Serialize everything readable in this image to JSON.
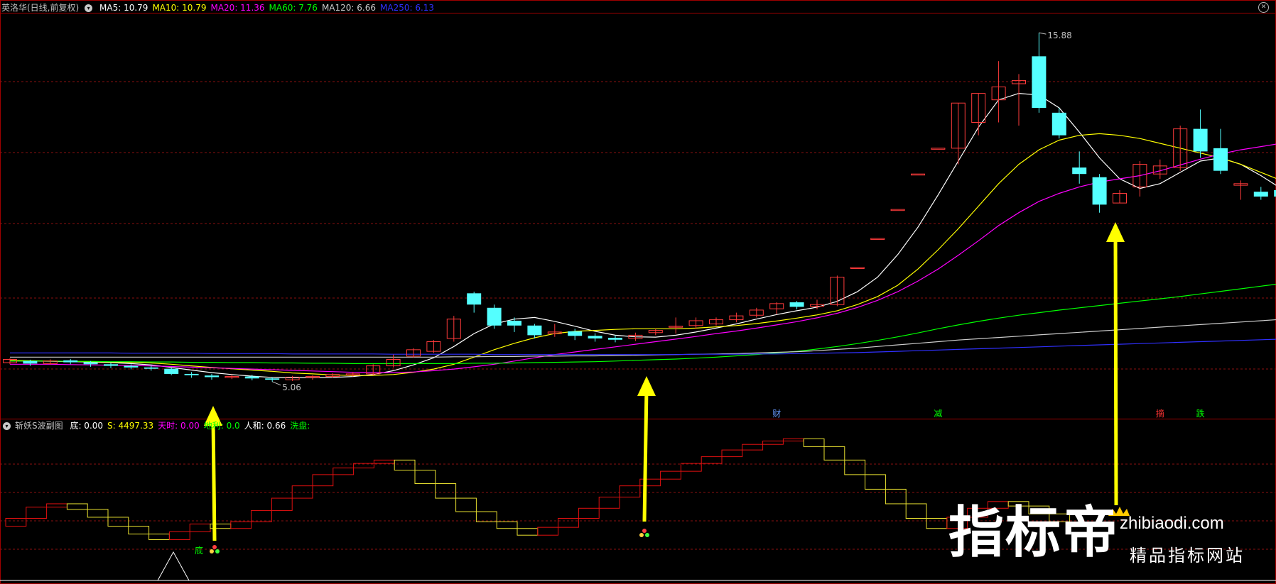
{
  "main_legend": {
    "title": "英洛华(日线,前复权)",
    "items": [
      {
        "label": "MA5: 10.79",
        "color": "#ffffff"
      },
      {
        "label": "MA10: 10.79",
        "color": "#ffff00"
      },
      {
        "label": "MA20: 11.36",
        "color": "#ff00ff"
      },
      {
        "label": "MA60: 7.76",
        "color": "#00ff00"
      },
      {
        "label": "MA120: 6.66",
        "color": "#cccccc"
      },
      {
        "label": "MA250: 6.13",
        "color": "#3030ff"
      }
    ]
  },
  "sub_legend": {
    "title": "斩妖S波副图",
    "items": [
      {
        "label": "底: 0.00",
        "color": "#ffffff"
      },
      {
        "label": "S: 4497.33",
        "color": "#ffff00"
      },
      {
        "label": "天时: 0.00",
        "color": "#ff00ff"
      },
      {
        "label": "地利: 0.0",
        "color": "#00ff00"
      },
      {
        "label": "人和: 0.66",
        "color": "#ffffff"
      },
      {
        "label": "洗盘:",
        "color": "#00ff00"
      }
    ]
  },
  "chart_data": {
    "type": "candlestick",
    "price_range": [
      4.0,
      16.5
    ],
    "annotations": {
      "high_label": "15.88",
      "low_label": "5.06",
      "bottom_label": "底"
    },
    "event_labels": [
      {
        "text": "财",
        "candle": 38,
        "color": "#6699ff"
      },
      {
        "text": "减",
        "candle": 46,
        "color": "#00ff00"
      },
      {
        "text": "摘",
        "candle": 57,
        "color": "#ff3333"
      },
      {
        "text": "跌",
        "candle": 59,
        "color": "#00ff00"
      }
    ],
    "candles": [
      [
        5.65,
        5.75,
        5.6,
        5.78
      ],
      [
        5.7,
        5.62,
        5.55,
        5.74
      ],
      [
        5.62,
        5.7,
        5.58,
        5.75
      ],
      [
        5.72,
        5.66,
        5.6,
        5.76
      ],
      [
        5.66,
        5.6,
        5.52,
        5.7
      ],
      [
        5.6,
        5.55,
        5.48,
        5.64
      ],
      [
        5.55,
        5.5,
        5.44,
        5.6
      ],
      [
        5.5,
        5.46,
        5.4,
        5.56
      ],
      [
        5.46,
        5.3,
        5.26,
        5.5
      ],
      [
        5.3,
        5.26,
        5.18,
        5.36
      ],
      [
        5.25,
        5.2,
        5.12,
        5.3
      ],
      [
        5.2,
        5.22,
        5.14,
        5.28
      ],
      [
        5.22,
        5.16,
        5.1,
        5.27
      ],
      [
        5.16,
        5.12,
        5.06,
        5.2
      ],
      [
        5.12,
        5.2,
        5.08,
        5.24
      ],
      [
        5.2,
        5.22,
        5.12,
        5.26
      ],
      [
        5.22,
        5.28,
        5.18,
        5.32
      ],
      [
        5.28,
        5.3,
        5.22,
        5.36
      ],
      [
        5.3,
        5.55,
        5.26,
        5.6
      ],
      [
        5.55,
        5.75,
        5.5,
        5.9
      ],
      [
        5.85,
        6.05,
        5.8,
        6.1
      ],
      [
        6.0,
        6.3,
        5.95,
        6.35
      ],
      [
        6.4,
        7.0,
        6.3,
        7.1
      ],
      [
        7.8,
        7.45,
        7.2,
        7.85
      ],
      [
        7.35,
        6.8,
        6.7,
        7.45
      ],
      [
        6.95,
        6.8,
        6.6,
        7.05
      ],
      [
        6.8,
        6.5,
        6.4,
        6.85
      ],
      [
        6.55,
        6.6,
        6.45,
        6.85
      ],
      [
        6.62,
        6.48,
        6.35,
        6.7
      ],
      [
        6.48,
        6.4,
        6.3,
        6.56
      ],
      [
        6.42,
        6.36,
        6.28,
        6.5
      ],
      [
        6.4,
        6.5,
        6.32,
        6.58
      ],
      [
        6.58,
        6.65,
        6.5,
        6.7
      ],
      [
        6.75,
        6.78,
        6.55,
        7.05
      ],
      [
        6.8,
        6.95,
        6.7,
        7.05
      ],
      [
        6.85,
        6.98,
        6.8,
        7.05
      ],
      [
        6.98,
        7.1,
        6.9,
        7.2
      ],
      [
        7.12,
        7.28,
        7.05,
        7.35
      ],
      [
        7.32,
        7.48,
        7.15,
        7.52
      ],
      [
        7.52,
        7.38,
        7.3,
        7.56
      ],
      [
        7.4,
        7.45,
        7.3,
        7.6
      ],
      [
        7.45,
        8.3,
        7.4,
        8.35
      ],
      [
        8.6,
        8.6,
        8.6,
        8.6
      ],
      [
        9.5,
        9.5,
        9.5,
        9.5
      ],
      [
        10.4,
        10.4,
        10.4,
        10.4
      ],
      [
        11.5,
        11.5,
        11.5,
        11.5
      ],
      [
        12.3,
        12.3,
        12.3,
        12.3
      ],
      [
        12.3,
        13.7,
        11.8,
        13.7
      ],
      [
        13.1,
        14.0,
        12.7,
        14.0
      ],
      [
        13.8,
        14.2,
        13.1,
        15.0
      ],
      [
        14.3,
        14.4,
        13.0,
        14.6
      ],
      [
        15.15,
        13.55,
        13.4,
        15.88
      ],
      [
        13.4,
        12.7,
        12.6,
        13.55
      ],
      [
        11.7,
        11.5,
        11.2,
        12.2
      ],
      [
        11.4,
        10.55,
        10.3,
        11.5
      ],
      [
        10.6,
        10.9,
        10.6,
        11.0
      ],
      [
        11.1,
        11.8,
        10.8,
        11.9
      ],
      [
        11.5,
        11.75,
        11.35,
        11.95
      ],
      [
        11.7,
        12.9,
        11.6,
        13.0
      ],
      [
        12.9,
        12.2,
        12.0,
        13.5
      ],
      [
        12.3,
        11.6,
        11.5,
        12.9
      ],
      [
        11.15,
        11.2,
        10.7,
        11.3
      ],
      [
        10.95,
        10.8,
        10.7,
        11.1
      ],
      [
        11.0,
        10.8,
        10.6,
        11.2
      ]
    ],
    "ma_series": [
      {
        "name": "MA5",
        "color": "#ffffff",
        "values": [
          5.7,
          5.7,
          5.69,
          5.68,
          5.67,
          5.65,
          5.62,
          5.58,
          5.5,
          5.42,
          5.34,
          5.28,
          5.23,
          5.19,
          5.18,
          5.18,
          5.19,
          5.22,
          5.28,
          5.4,
          5.58,
          5.8,
          6.15,
          6.55,
          6.85,
          7.0,
          7.05,
          6.93,
          6.78,
          6.62,
          6.5,
          6.45,
          6.44,
          6.5,
          6.6,
          6.72,
          6.85,
          7.0,
          7.14,
          7.26,
          7.37,
          7.55,
          7.85,
          8.3,
          9.0,
          9.85,
          10.85,
          11.9,
          12.95,
          13.8,
          14.0,
          13.95,
          13.55,
          12.8,
          12.0,
          11.35,
          11.05,
          11.2,
          11.55,
          11.9,
          12.0,
          11.8,
          11.45,
          11.05
        ]
      },
      {
        "name": "MA10",
        "color": "#ffff00",
        "values": [
          5.72,
          5.71,
          5.7,
          5.69,
          5.68,
          5.67,
          5.66,
          5.64,
          5.6,
          5.55,
          5.5,
          5.46,
          5.42,
          5.38,
          5.33,
          5.3,
          5.27,
          5.25,
          5.25,
          5.28,
          5.35,
          5.45,
          5.6,
          5.82,
          6.05,
          6.25,
          6.42,
          6.55,
          6.62,
          6.65,
          6.68,
          6.7,
          6.7,
          6.7,
          6.72,
          6.76,
          6.8,
          6.86,
          6.94,
          7.03,
          7.13,
          7.26,
          7.45,
          7.7,
          8.05,
          8.55,
          9.15,
          9.8,
          10.5,
          11.2,
          11.8,
          12.25,
          12.55,
          12.7,
          12.75,
          12.7,
          12.6,
          12.45,
          12.3,
          12.15,
          12.0,
          11.8,
          11.55,
          11.3
        ]
      },
      {
        "name": "MA20",
        "color": "#ff00ff",
        "values": [
          5.6,
          5.6,
          5.6,
          5.59,
          5.58,
          5.57,
          5.56,
          5.55,
          5.53,
          5.51,
          5.49,
          5.47,
          5.45,
          5.43,
          5.41,
          5.39,
          5.37,
          5.35,
          5.34,
          5.34,
          5.36,
          5.4,
          5.45,
          5.52,
          5.6,
          5.7,
          5.8,
          5.9,
          5.98,
          6.06,
          6.14,
          6.22,
          6.3,
          6.38,
          6.46,
          6.55,
          6.63,
          6.72,
          6.82,
          6.92,
          7.04,
          7.18,
          7.36,
          7.58,
          7.85,
          8.18,
          8.55,
          8.98,
          9.43,
          9.9,
          10.3,
          10.65,
          10.9,
          11.1,
          11.25,
          11.35,
          11.45,
          11.6,
          11.78,
          11.96,
          12.12,
          12.25,
          12.35,
          12.45
        ]
      },
      {
        "name": "MA60",
        "color": "#00ff00",
        "values": [
          5.7,
          5.7,
          5.7,
          5.69,
          5.69,
          5.68,
          5.68,
          5.67,
          5.67,
          5.66,
          5.66,
          5.65,
          5.65,
          5.64,
          5.64,
          5.63,
          5.63,
          5.62,
          5.62,
          5.62,
          5.62,
          5.62,
          5.62,
          5.63,
          5.63,
          5.64,
          5.65,
          5.66,
          5.67,
          5.68,
          5.7,
          5.72,
          5.74,
          5.76,
          5.79,
          5.82,
          5.86,
          5.9,
          5.95,
          6.0,
          6.07,
          6.15,
          6.24,
          6.34,
          6.45,
          6.57,
          6.7,
          6.82,
          6.93,
          7.03,
          7.12,
          7.2,
          7.28,
          7.35,
          7.42,
          7.49,
          7.56,
          7.63,
          7.7,
          7.78,
          7.86,
          7.94,
          8.02,
          8.1
        ]
      },
      {
        "name": "MA120",
        "color": "#cccccc",
        "values": [
          5.82,
          5.82,
          5.82,
          5.82,
          5.82,
          5.82,
          5.82,
          5.82,
          5.82,
          5.82,
          5.82,
          5.82,
          5.82,
          5.82,
          5.82,
          5.82,
          5.82,
          5.82,
          5.82,
          5.82,
          5.82,
          5.82,
          5.83,
          5.83,
          5.84,
          5.84,
          5.85,
          5.85,
          5.86,
          5.86,
          5.87,
          5.88,
          5.89,
          5.9,
          5.91,
          5.92,
          5.93,
          5.95,
          5.97,
          5.99,
          6.02,
          6.06,
          6.1,
          6.15,
          6.2,
          6.25,
          6.3,
          6.35,
          6.39,
          6.43,
          6.47,
          6.51,
          6.55,
          6.59,
          6.63,
          6.67,
          6.71,
          6.75,
          6.79,
          6.83,
          6.87,
          6.91,
          6.95,
          6.99
        ]
      },
      {
        "name": "MA250",
        "color": "#3030ff",
        "values": [
          5.95,
          5.95,
          5.95,
          5.95,
          5.95,
          5.95,
          5.94,
          5.94,
          5.94,
          5.94,
          5.93,
          5.93,
          5.93,
          5.93,
          5.92,
          5.92,
          5.92,
          5.92,
          5.92,
          5.91,
          5.91,
          5.91,
          5.91,
          5.91,
          5.9,
          5.9,
          5.9,
          5.9,
          5.9,
          5.9,
          5.9,
          5.9,
          5.9,
          5.9,
          5.91,
          5.91,
          5.91,
          5.92,
          5.92,
          5.93,
          5.94,
          5.95,
          5.96,
          5.98,
          6.0,
          6.02,
          6.04,
          6.06,
          6.08,
          6.1,
          6.12,
          6.14,
          6.16,
          6.18,
          6.2,
          6.22,
          6.24,
          6.26,
          6.28,
          6.3,
          6.32,
          6.34,
          6.36,
          6.38
        ]
      }
    ],
    "sub_indicator": {
      "range": [
        0,
        100
      ],
      "steps": [
        {
          "v": [
            18,
            25
          ],
          "c": "r"
        },
        {
          "v": [
            25,
            35
          ],
          "c": "r"
        },
        {
          "v": [
            35,
            38
          ],
          "c": "r"
        },
        {
          "v": [
            38,
            33
          ],
          "c": "y"
        },
        {
          "v": [
            33,
            26
          ],
          "c": "y"
        },
        {
          "v": [
            26,
            18
          ],
          "c": "y"
        },
        {
          "v": [
            18,
            11
          ],
          "c": "y"
        },
        {
          "v": [
            11,
            6
          ],
          "c": "y"
        },
        {
          "v": [
            6,
            13
          ],
          "c": "r"
        },
        {
          "v": [
            13,
            20
          ],
          "c": "r"
        },
        {
          "v": [
            20,
            16
          ],
          "c": "y"
        },
        {
          "v": [
            16,
            22
          ],
          "c": "r"
        },
        {
          "v": [
            22,
            32
          ],
          "c": "r"
        },
        {
          "v": [
            32,
            43
          ],
          "c": "r"
        },
        {
          "v": [
            43,
            54
          ],
          "c": "r"
        },
        {
          "v": [
            54,
            64
          ],
          "c": "r"
        },
        {
          "v": [
            64,
            70
          ],
          "c": "r"
        },
        {
          "v": [
            70,
            74
          ],
          "c": "r"
        },
        {
          "v": [
            74,
            77
          ],
          "c": "r"
        },
        {
          "v": [
            77,
            68
          ],
          "c": "y"
        },
        {
          "v": [
            68,
            56
          ],
          "c": "y"
        },
        {
          "v": [
            56,
            43
          ],
          "c": "y"
        },
        {
          "v": [
            43,
            31
          ],
          "c": "y"
        },
        {
          "v": [
            31,
            22
          ],
          "c": "y"
        },
        {
          "v": [
            22,
            16
          ],
          "c": "y"
        },
        {
          "v": [
            16,
            10
          ],
          "c": "y"
        },
        {
          "v": [
            10,
            17
          ],
          "c": "r"
        },
        {
          "v": [
            17,
            25
          ],
          "c": "r"
        },
        {
          "v": [
            25,
            34
          ],
          "c": "r"
        },
        {
          "v": [
            34,
            44
          ],
          "c": "r"
        },
        {
          "v": [
            44,
            54
          ],
          "c": "r"
        },
        {
          "v": [
            54,
            60
          ],
          "c": "r"
        },
        {
          "v": [
            60,
            67
          ],
          "c": "r"
        },
        {
          "v": [
            67,
            74
          ],
          "c": "r"
        },
        {
          "v": [
            74,
            80
          ],
          "c": "r"
        },
        {
          "v": [
            80,
            86
          ],
          "c": "r"
        },
        {
          "v": [
            86,
            91
          ],
          "c": "r"
        },
        {
          "v": [
            91,
            94
          ],
          "c": "r"
        },
        {
          "v": [
            94,
            96
          ],
          "c": "r"
        },
        {
          "v": [
            96,
            89
          ],
          "c": "y"
        },
        {
          "v": [
            89,
            77
          ],
          "c": "y"
        },
        {
          "v": [
            77,
            64
          ],
          "c": "y"
        },
        {
          "v": [
            64,
            51
          ],
          "c": "y"
        },
        {
          "v": [
            51,
            38
          ],
          "c": "y"
        },
        {
          "v": [
            38,
            25
          ],
          "c": "y"
        },
        {
          "v": [
            25,
            16
          ],
          "c": "y"
        },
        {
          "v": [
            16,
            26
          ],
          "c": "r"
        },
        {
          "v": [
            26,
            34
          ],
          "c": "r"
        },
        {
          "v": [
            34,
            40
          ],
          "c": "r"
        },
        {
          "v": [
            40,
            36
          ],
          "c": "y"
        },
        {
          "v": [
            36,
            29
          ],
          "c": "y"
        },
        {
          "v": [
            29,
            22
          ],
          "c": "y"
        }
      ]
    },
    "arrows": [
      {
        "x_candle": 10.3
      },
      {
        "x_candle": 31.3
      },
      {
        "x_candle": 54.6
      }
    ]
  },
  "watermark": {
    "big": "指标帝",
    "url": "zhibiaodi.com",
    "sub": "精品指标网站"
  }
}
